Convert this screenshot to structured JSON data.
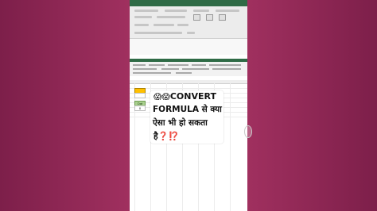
{
  "caption": {
    "line1_emoji": "😱😱",
    "line1_text": "CONVERT",
    "line2": "FORMULA से क्या",
    "line3": "ऐसा भी हो सकता",
    "line4_text": "है",
    "line4_marks": "❓⁉️"
  },
  "spreadsheet": {
    "green_cell_label": "Dat",
    "cell_value": "0"
  },
  "colors": {
    "background": "#8e2555",
    "excel_green": "#2f6b46",
    "yellow_fill": "#ffc000",
    "green_fill": "#a9d08e",
    "question_red": "#e11d2a"
  }
}
